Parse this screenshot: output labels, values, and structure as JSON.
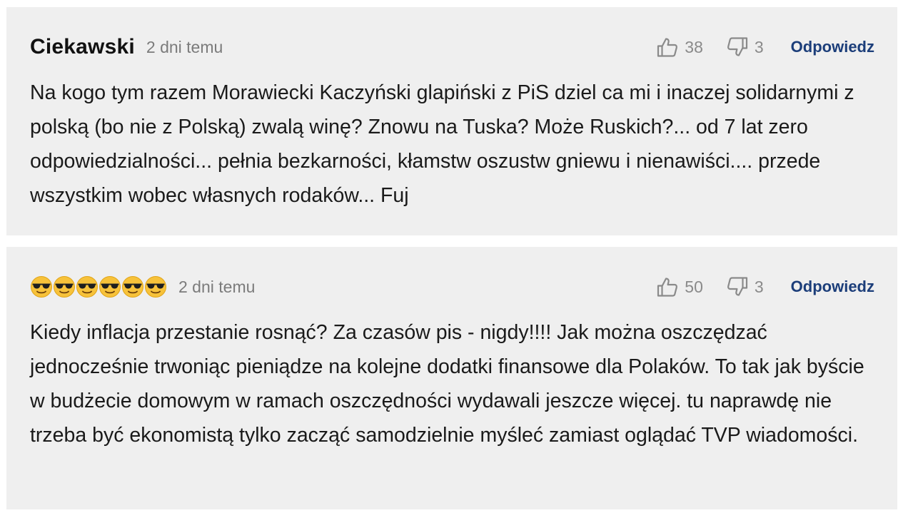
{
  "comments": [
    {
      "author": "Ciekawski",
      "time": "2 dni temu",
      "upvotes": "38",
      "downvotes": "3",
      "reply_label": "Odpowiedz",
      "text": "Na kogo tym razem Morawiecki Kaczyński glapiński z PiS dziel ca mi i inaczej solidarnymi z polską (bo nie z Polską) zwalą winę? Znowu na Tuska? Może Ruskich?... od 7 lat zero odpowiedzialności... pełnia bezkarności, kłamstw oszustw gniewu i nienawiści.... przede wszystkim wobec własnych rodaków... Fuj"
    },
    {
      "author": "😎😎😎😎😎😎",
      "time": "2 dni temu",
      "upvotes": "50",
      "downvotes": "3",
      "reply_label": "Odpowiedz",
      "text": "Kiedy inflacja przestanie rosnąć? Za czasów pis - nigdy!!!! Jak można oszczędzać jednocześnie trwoniąc pieniądze na kolejne dodatki finansowe dla Polaków. To tak jak byście w budżecie domowym w ramach oszczędności wydawali jeszcze więcej. tu naprawdę nie trzeba być ekonomistą tylko zacząć samodzielnie myśleć zamiast oglądać TVP wiadomości."
    }
  ],
  "icons": {
    "upvote": "thumbs-up-icon",
    "downvote": "thumbs-down-icon",
    "author_emoji": "sunglasses-face-emoji-icon"
  },
  "colors": {
    "card_background": "#efefef",
    "reply_link": "#1c3e7a",
    "muted_text": "#7b7b7b"
  }
}
